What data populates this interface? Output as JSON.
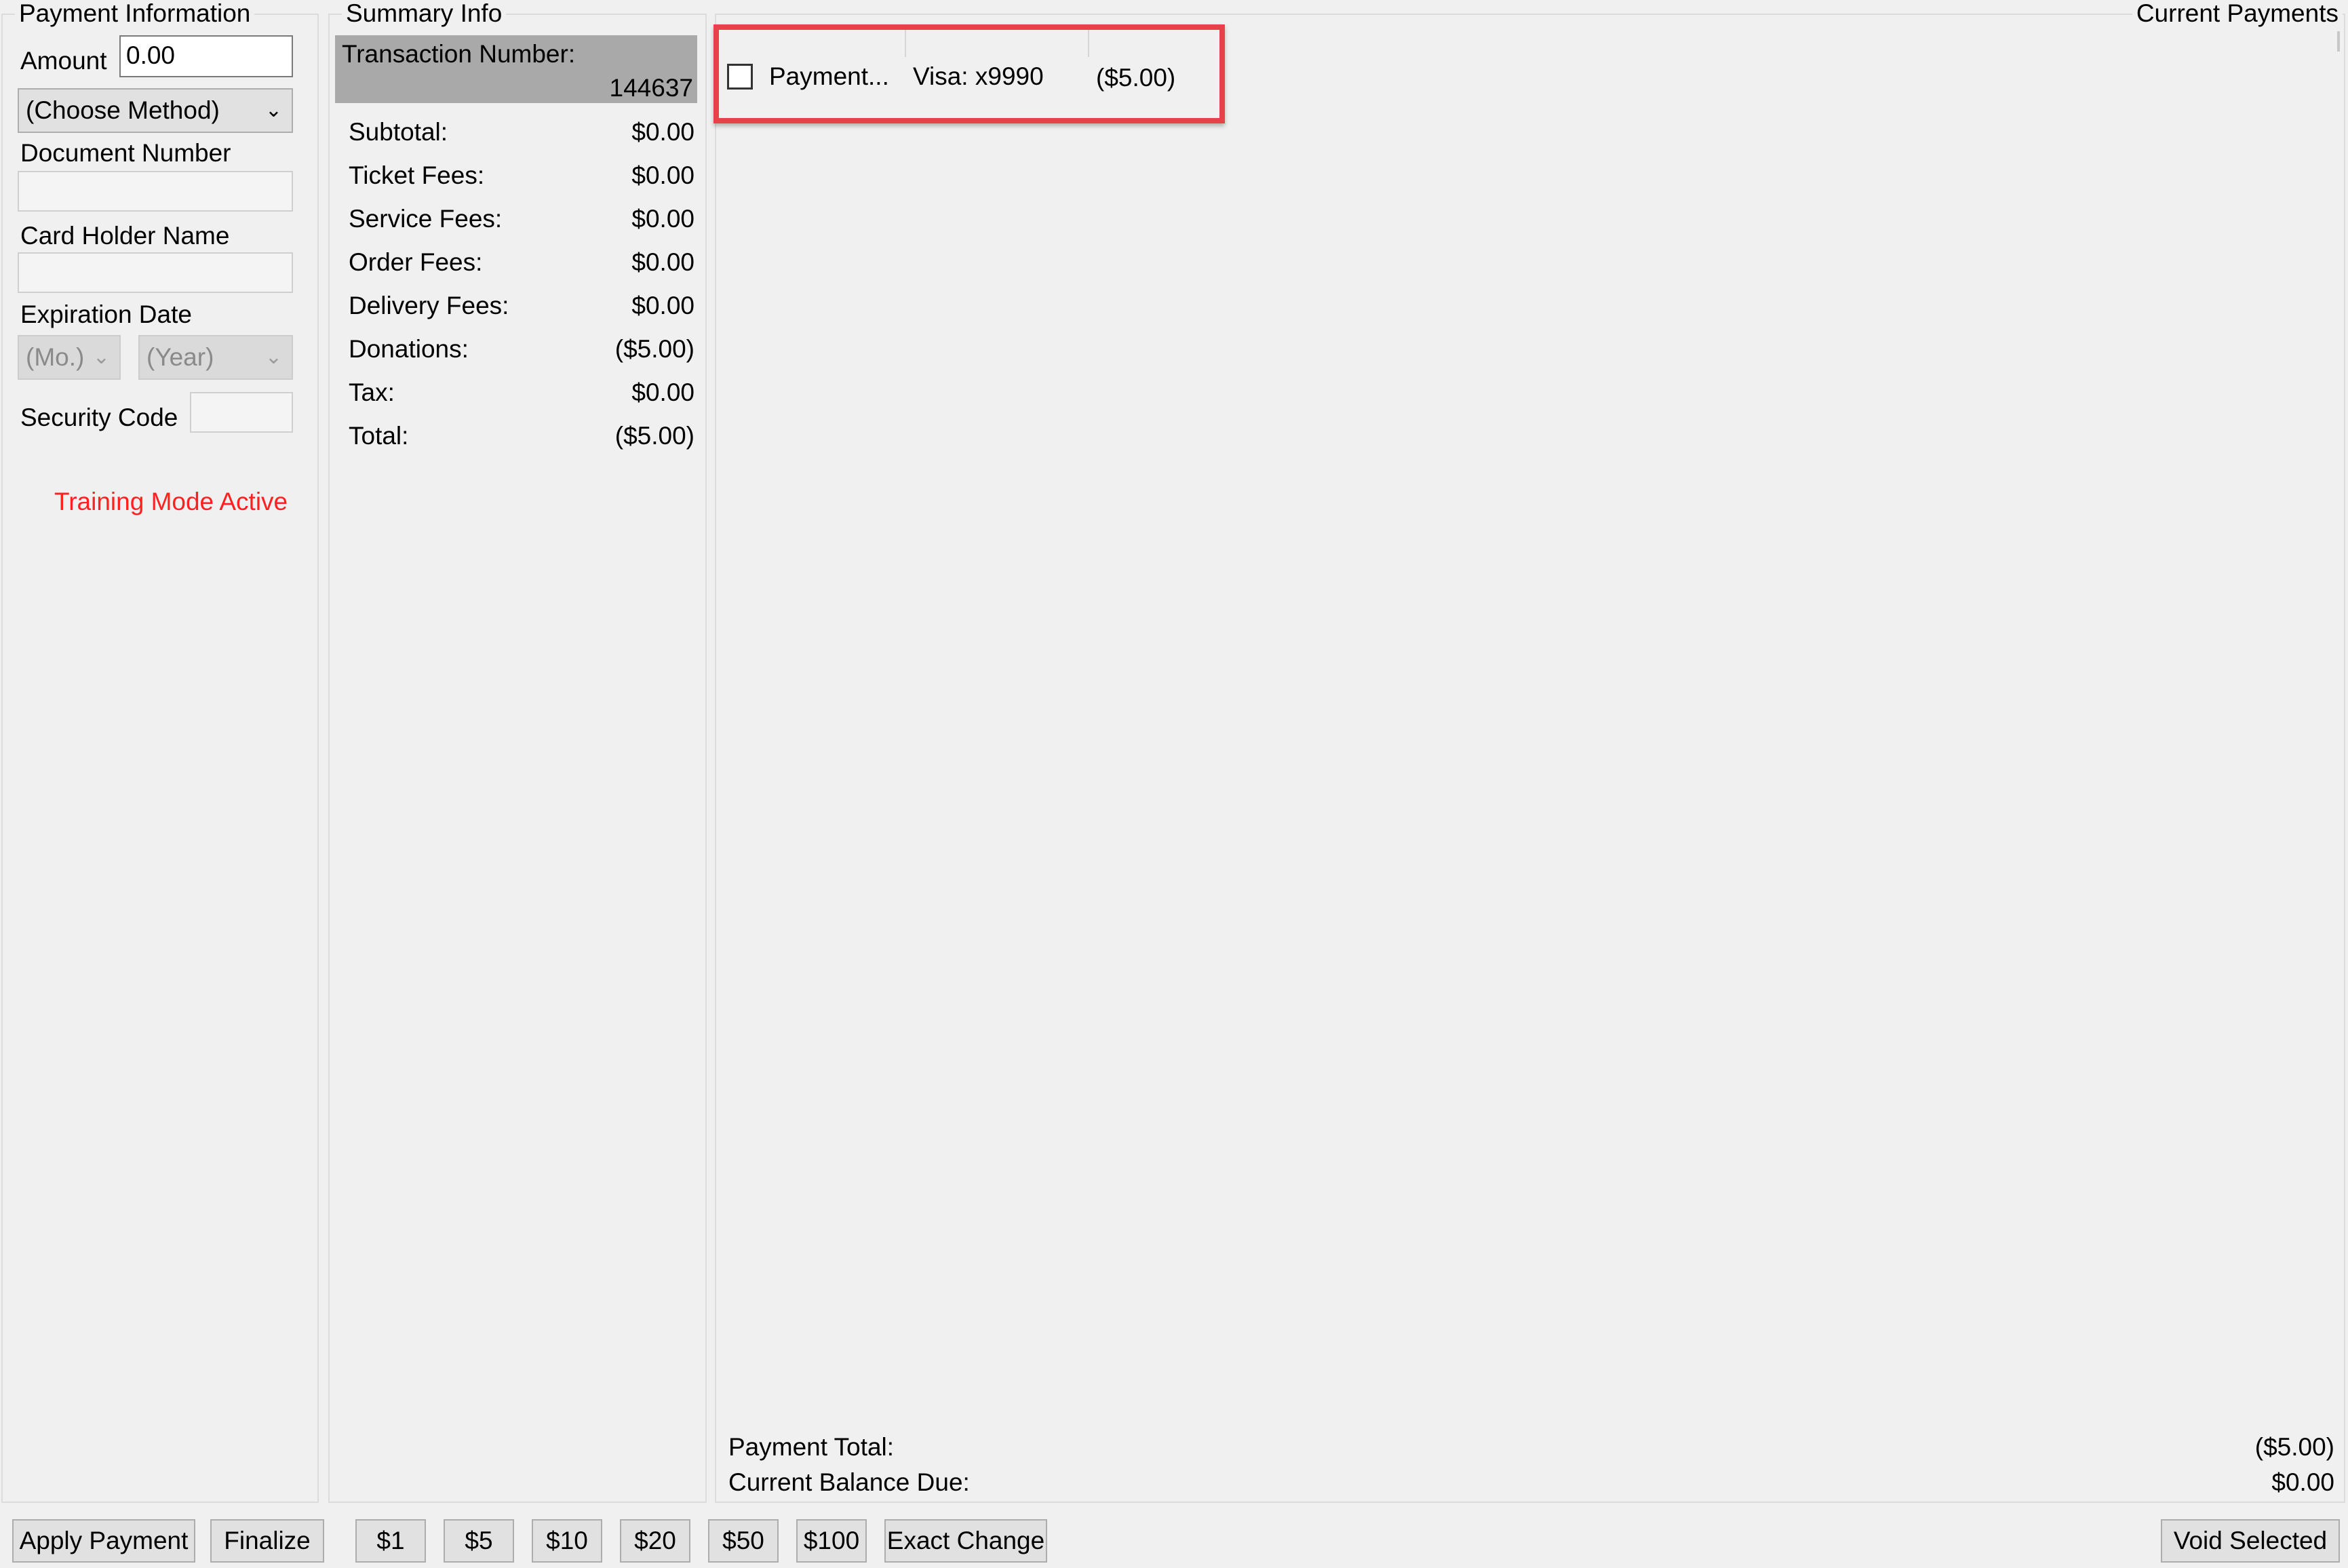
{
  "payment_info": {
    "title": "Payment Information",
    "amount_label": "Amount",
    "amount_value": "0.00",
    "method_select": "(Choose Method)",
    "document_number_label": "Document Number",
    "document_number_value": "",
    "card_holder_label": "Card Holder Name",
    "card_holder_value": "",
    "expiration_label": "Expiration Date",
    "month_select": "(Mo.)",
    "year_select": "(Year)",
    "security_code_label": "Security Code",
    "security_code_value": "",
    "training_mode_text": "Training Mode Active"
  },
  "summary": {
    "title": "Summary Info",
    "transaction_label": "Transaction Number:",
    "transaction_number": "144637",
    "rows": [
      {
        "label": "Subtotal:",
        "value": "$0.00"
      },
      {
        "label": "Ticket Fees:",
        "value": "$0.00"
      },
      {
        "label": "Service Fees:",
        "value": "$0.00"
      },
      {
        "label": "Order Fees:",
        "value": "$0.00"
      },
      {
        "label": "Delivery Fees:",
        "value": "$0.00"
      },
      {
        "label": "Donations:",
        "value": "($5.00)"
      },
      {
        "label": "Tax:",
        "value": "$0.00"
      },
      {
        "label": "Total:",
        "value": "($5.00)"
      }
    ]
  },
  "current_payments": {
    "title": "Current Payments",
    "items": [
      {
        "type": "Payment...",
        "method": "Visa: x9990",
        "amount": "($5.00)",
        "checked": false
      }
    ],
    "payment_total_label": "Payment Total:",
    "payment_total_value": "($5.00)",
    "balance_due_label": "Current Balance Due:",
    "balance_due_value": "$0.00"
  },
  "buttons": {
    "apply_payment": "Apply Payment",
    "finalize": "Finalize",
    "quick_1": "$1",
    "quick_5": "$5",
    "quick_10": "$10",
    "quick_20": "$20",
    "quick_50": "$50",
    "quick_100": "$100",
    "exact_change": "Exact Change",
    "void_selected": "Void Selected"
  },
  "colors": {
    "window_bg": "#f0f0f0",
    "transaction_header_bg": "#a9a9a9",
    "training_mode_text": "#ff2020",
    "highlight_box": "#e8414a"
  },
  "icons": {
    "dropdown": "chevron-down-icon",
    "row_checkbox": "checkbox-icon"
  }
}
